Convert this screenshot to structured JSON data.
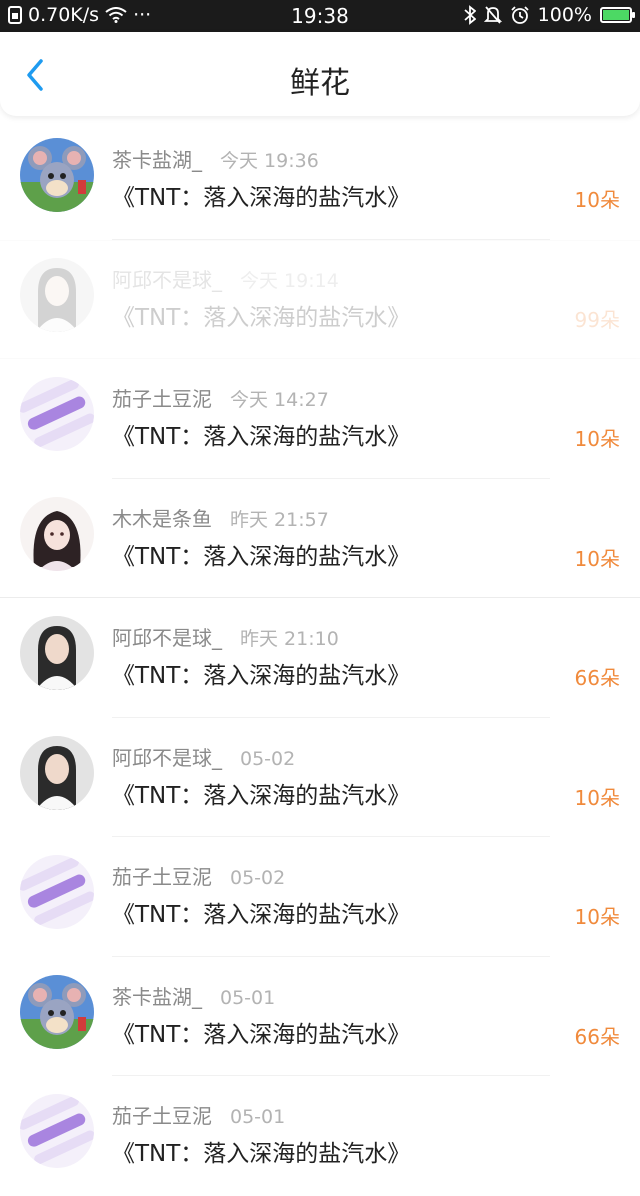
{
  "status_bar": {
    "network_speed": "0.70K/s",
    "more": "···",
    "time": "19:38",
    "battery": "100%"
  },
  "header": {
    "title": "鲜花"
  },
  "items": [
    {
      "user": "茶卡盐湖_",
      "time": "今天 19:36",
      "work": "《TNT：落入深海的盐汽水》",
      "count": "10朵",
      "avatar": "cartoon-mouse"
    },
    {
      "user": "阿邱不是球_",
      "time": "今天 19:14",
      "work": "《TNT：落入深海的盐汽水》",
      "count": "99朵",
      "avatar": "girl-portrait"
    },
    {
      "user": "茄子土豆泥",
      "time": "今天 14:27",
      "work": "《TNT：落入深海的盐汽水》",
      "count": "10朵",
      "avatar": "purple-sticker"
    },
    {
      "user": "木木是条鱼",
      "time": "昨天 21:57",
      "work": "《TNT：落入深海的盐汽水》",
      "count": "10朵",
      "avatar": "anime-girl"
    },
    {
      "user": "阿邱不是球_",
      "time": "昨天 21:10",
      "work": "《TNT：落入深海的盐汽水》",
      "count": "66朵",
      "avatar": "girl-portrait"
    },
    {
      "user": "阿邱不是球_",
      "time": "05-02",
      "work": "《TNT：落入深海的盐汽水》",
      "count": "10朵",
      "avatar": "girl-portrait"
    },
    {
      "user": "茄子土豆泥",
      "time": "05-02",
      "work": "《TNT：落入深海的盐汽水》",
      "count": "10朵",
      "avatar": "purple-sticker"
    },
    {
      "user": "茶卡盐湖_",
      "time": "05-01",
      "work": "《TNT：落入深海的盐汽水》",
      "count": "66朵",
      "avatar": "cartoon-mouse"
    },
    {
      "user": "茄子土豆泥",
      "time": "05-01",
      "work": "《TNT：落入深海的盐汽水》",
      "count": "",
      "avatar": "purple-sticker"
    }
  ],
  "colors": {
    "accent": "#1e9bf0",
    "count": "#f08a3c"
  }
}
